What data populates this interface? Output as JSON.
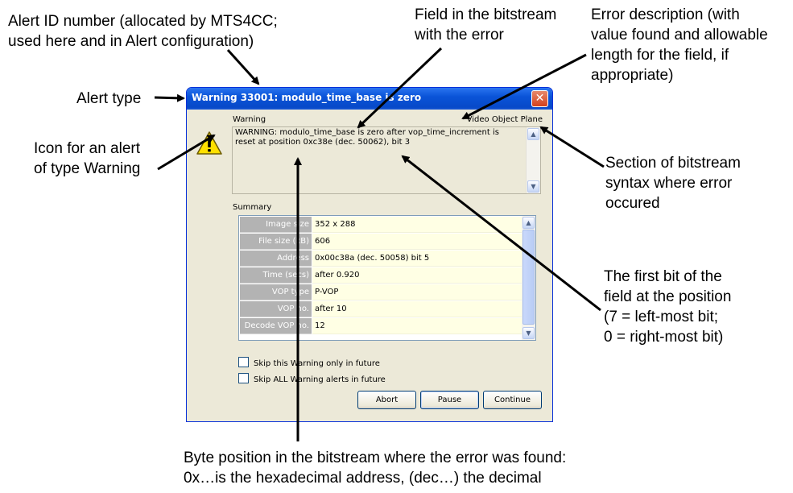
{
  "dialog": {
    "title": "Warning 33001: modulo_time_base is zero",
    "close_glyph": "✕",
    "alert_type_label": "Warning",
    "section_label": "Video Object Plane",
    "message": "WARNING: modulo_time_base is zero after vop_time_increment is reset at position 0xc38e (dec. 50062), bit 3",
    "summary_label": "Summary",
    "summary_rows": [
      {
        "key": "Image size",
        "value": "352 x 288"
      },
      {
        "key": "File size (kB)",
        "value": "606"
      },
      {
        "key": "Address",
        "value": "0x00c38a (dec. 50058) bit 5"
      },
      {
        "key": "Time (secs)",
        "value": "after 0.920"
      },
      {
        "key": "VOP type",
        "value": "P-VOP"
      },
      {
        "key": "VOP no.",
        "value": "after 10"
      },
      {
        "key": "Decode VOP no.",
        "value": "12"
      }
    ],
    "skip_this": "Skip this Warning only in future",
    "skip_all": "Skip ALL Warning alerts in future",
    "buttons": {
      "abort": "Abort",
      "pause": "Pause",
      "continue": "Continue"
    },
    "icons": {
      "warning": "warning-triangle-icon",
      "close": "close-icon",
      "scroll_up": "chevron-up-icon",
      "scroll_down": "chevron-down-icon"
    }
  },
  "callouts": {
    "alert_id": "Alert ID number (allocated by MTS4CC;\nused here and in Alert configuration)",
    "field": "Field in the bitstream\nwith the error",
    "error_desc": "Error description (with\nvalue found and allowable\nlength for the field, if\nappropriate)",
    "alert_type": "Alert type",
    "icon": "Icon for an alert\nof type Warning",
    "section": "Section of bitstream\nsyntax where error\noccured",
    "first_bit": "The first bit of the\nfield at the position\n(7 = left-most bit;\n0 = right-most bit)",
    "byte_pos": "Byte position in the bitstream where the error was found:\n0x…is the hexadecimal address, (dec…) the decimal"
  },
  "colors": {
    "titlebar": "#0a54d8",
    "dialog_bg": "#ece9d8",
    "key_bg": "#b3b3b3",
    "value_bg": "#ffffe4"
  }
}
